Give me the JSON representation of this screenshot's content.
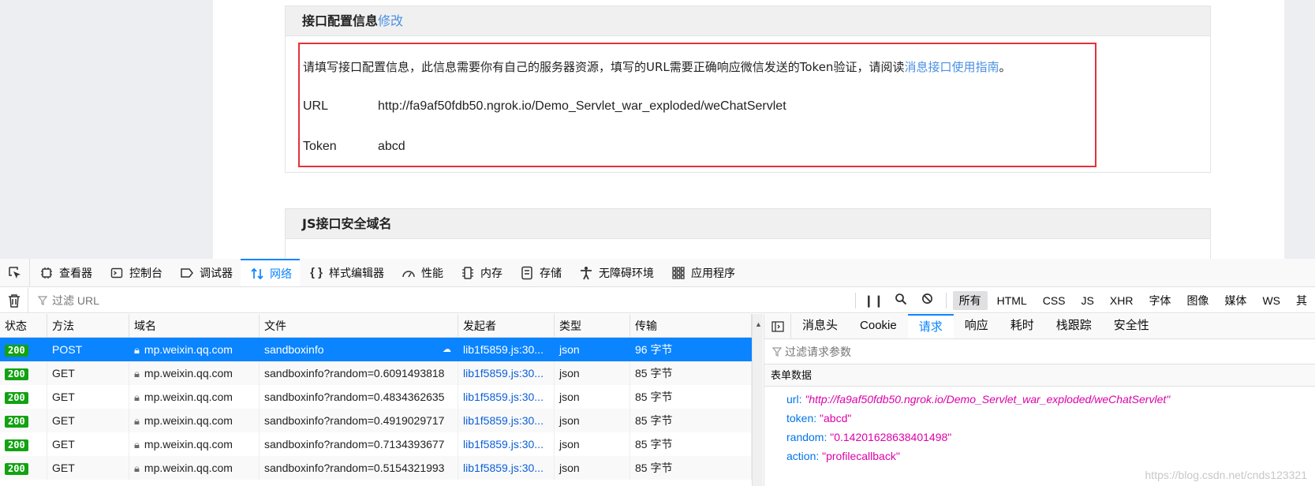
{
  "web": {
    "panel1": {
      "title": "接口配置信息",
      "edit_link": "修改",
      "description": "请填写接口配置信息，此信息需要你有自己的服务器资源，填写的URL需要正确响应微信发送的Token验证，请阅读",
      "guide_link": "消息接口使用指南",
      "end_punct": "。",
      "url_label": "URL",
      "url_value": "http://fa9af50fdb50.ngrok.io/Demo_Servlet_war_exploded/weChatServlet",
      "token_label": "Token",
      "token_value": "abcd"
    },
    "panel2": {
      "title": "JS接口安全域名"
    }
  },
  "devtools": {
    "tabs": [
      {
        "label": "查看器",
        "icon": "inspector-icon"
      },
      {
        "label": "控制台",
        "icon": "console-icon"
      },
      {
        "label": "调试器",
        "icon": "debugger-icon"
      },
      {
        "label": "网络",
        "icon": "network-icon"
      },
      {
        "label": "样式编辑器",
        "icon": "style-editor-icon"
      },
      {
        "label": "性能",
        "icon": "performance-icon"
      },
      {
        "label": "内存",
        "icon": "memory-icon"
      },
      {
        "label": "存储",
        "icon": "storage-icon"
      },
      {
        "label": "无障碍环境",
        "icon": "accessibility-icon"
      },
      {
        "label": "应用程序",
        "icon": "application-icon"
      }
    ],
    "active_tab": "网络",
    "filter_placeholder": "过滤 URL",
    "filter_types": [
      "所有",
      "HTML",
      "CSS",
      "JS",
      "XHR",
      "字体",
      "图像",
      "媒体",
      "WS",
      "其"
    ],
    "columns": {
      "status": "状态",
      "method": "方法",
      "domain": "域名",
      "file": "文件",
      "initiator": "发起者",
      "type": "类型",
      "transferred": "传输"
    },
    "requests": [
      {
        "status": "200",
        "method": "POST",
        "domain": "mp.weixin.qq.com",
        "file": "sandboxinfo",
        "initiator": "lib1f5859.js:30...",
        "type": "json",
        "size": "96 字节",
        "selected": true
      },
      {
        "status": "200",
        "method": "GET",
        "domain": "mp.weixin.qq.com",
        "file": "sandboxinfo?random=0.6091493818",
        "initiator": "lib1f5859.js:30...",
        "type": "json",
        "size": "85 字节",
        "selected": false
      },
      {
        "status": "200",
        "method": "GET",
        "domain": "mp.weixin.qq.com",
        "file": "sandboxinfo?random=0.4834362635",
        "initiator": "lib1f5859.js:30...",
        "type": "json",
        "size": "85 字节",
        "selected": false
      },
      {
        "status": "200",
        "method": "GET",
        "domain": "mp.weixin.qq.com",
        "file": "sandboxinfo?random=0.4919029717",
        "initiator": "lib1f5859.js:30...",
        "type": "json",
        "size": "85 字节",
        "selected": false
      },
      {
        "status": "200",
        "method": "GET",
        "domain": "mp.weixin.qq.com",
        "file": "sandboxinfo?random=0.7134393677",
        "initiator": "lib1f5859.js:30...",
        "type": "json",
        "size": "85 字节",
        "selected": false
      },
      {
        "status": "200",
        "method": "GET",
        "domain": "mp.weixin.qq.com",
        "file": "sandboxinfo?random=0.5154321993",
        "initiator": "lib1f5859.js:30...",
        "type": "json",
        "size": "85 字节",
        "selected": false
      }
    ],
    "details": {
      "tabs": [
        "消息头",
        "Cookie",
        "请求",
        "响应",
        "耗时",
        "栈跟踪",
        "安全性"
      ],
      "active_tab": "请求",
      "param_filter_placeholder": "过滤请求参数",
      "form_header": "表单数据",
      "params": [
        {
          "key": "url",
          "value": "\"http://fa9af50fdb50.ngrok.io/Demo_Servlet_war_exploded/weChatServlet\""
        },
        {
          "key": "token",
          "value": "\"abcd\""
        },
        {
          "key": "random",
          "value": "\"0.14201628638401498\""
        },
        {
          "key": "action",
          "value": "\"profilecallback\""
        }
      ]
    },
    "colors": {
      "accent": "#0a84ff",
      "status_ok": "#12a212",
      "param_key": "#0074e8",
      "param_value": "#dd00a9",
      "highlight_box": "#e4323a"
    }
  },
  "watermark": "https://blog.csdn.net/cnds123321"
}
